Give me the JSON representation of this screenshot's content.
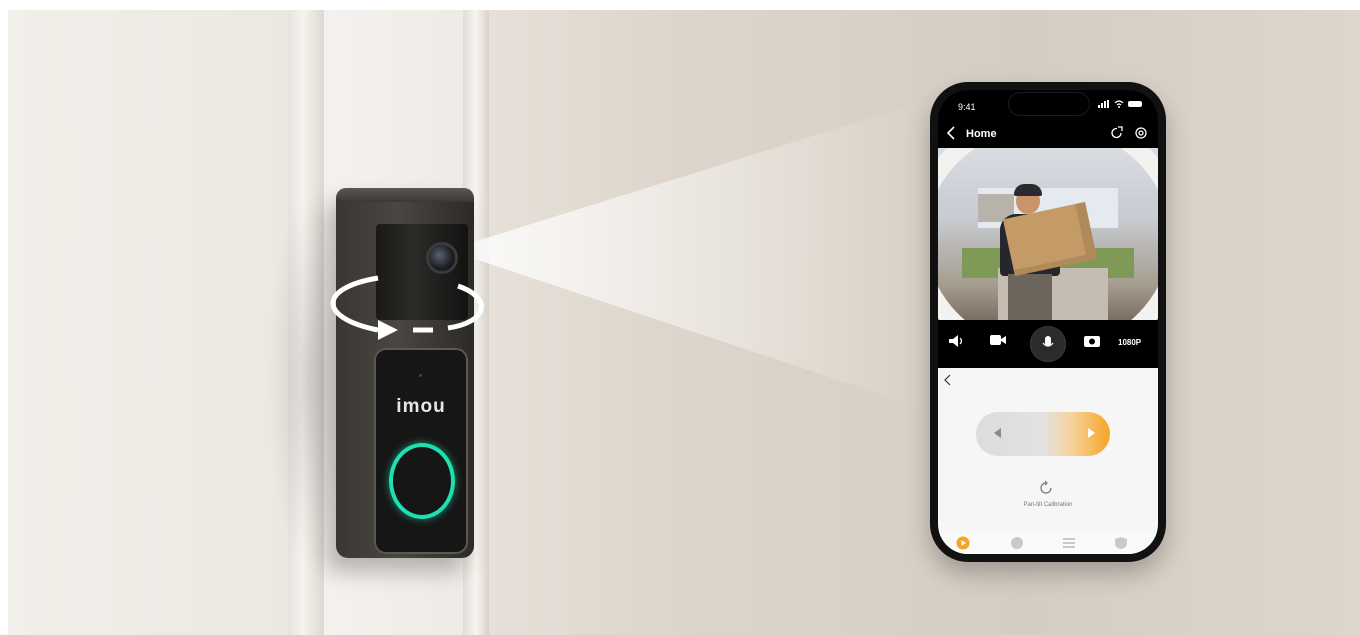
{
  "doorbell": {
    "brand": "imou"
  },
  "phone": {
    "status_time": "9:41",
    "header_title": "Home",
    "resolution": "1080P",
    "calibration_label": "Pan-tilt Calibration",
    "slider": {
      "position_fraction": 1.0
    },
    "tabs": [
      {
        "name": "live",
        "active": true
      },
      {
        "name": "messages",
        "active": false
      },
      {
        "name": "list",
        "active": false
      },
      {
        "name": "security",
        "active": false
      }
    ]
  },
  "colors": {
    "accent": "#F5A524",
    "ring_led": "#1FE0B0",
    "doorbell_body": "#3F3B37"
  },
  "icons": [
    "back-icon",
    "share-icon",
    "gear-icon",
    "speaker-icon",
    "record-icon",
    "mic-icon",
    "camera-icon",
    "calibrate-icon"
  ]
}
